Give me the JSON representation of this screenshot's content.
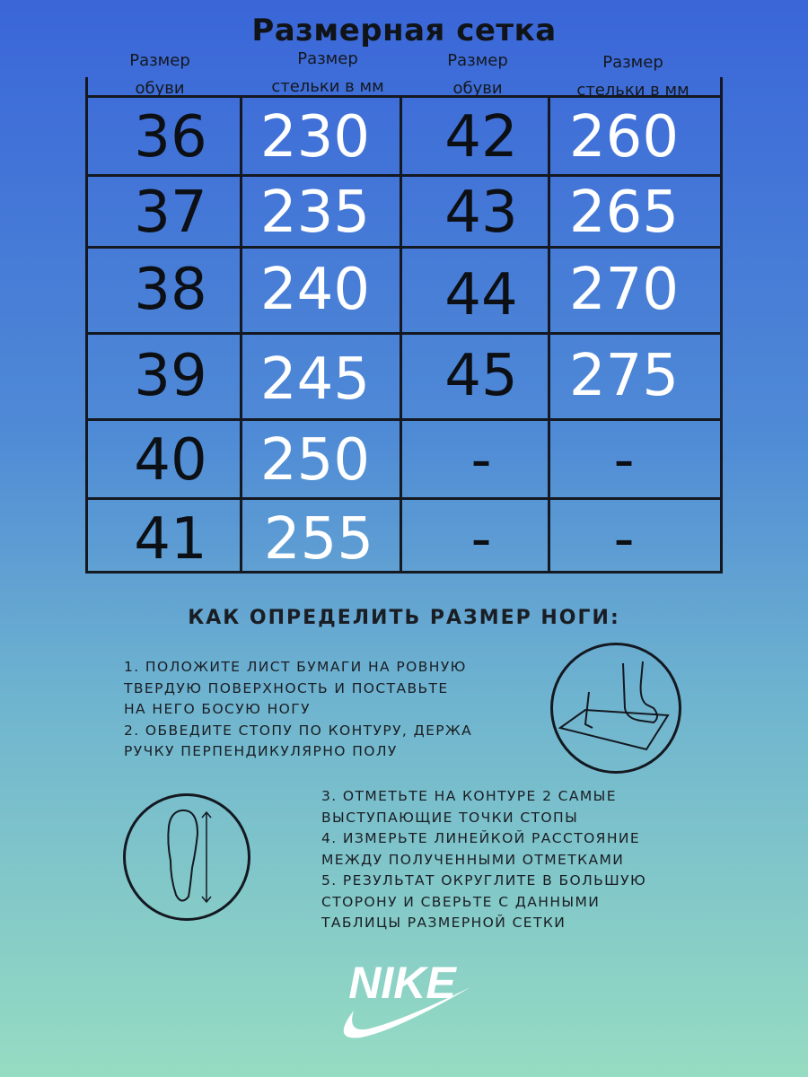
{
  "title": "Размерная сетка",
  "headers": [
    {
      "line1": "Размер",
      "line2": "обуви"
    },
    {
      "line1": "Размер",
      "line2": "стельки в мм"
    },
    {
      "line1": "Размер",
      "line2": "обуви"
    },
    {
      "line1": "Размер",
      "line2": "стельки в мм"
    }
  ],
  "rows": [
    {
      "shoe_a": "36",
      "insole_a": "230",
      "shoe_b": "42",
      "insole_b": "260"
    },
    {
      "shoe_a": "37",
      "insole_a": "235",
      "shoe_b": "43",
      "insole_b": "265"
    },
    {
      "shoe_a": "38",
      "insole_a": "240",
      "shoe_b": "44",
      "insole_b": "270"
    },
    {
      "shoe_a": "39",
      "insole_a": "245",
      "shoe_b": "45",
      "insole_b": "275"
    },
    {
      "shoe_a": "40",
      "insole_a": "250",
      "shoe_b": "-",
      "insole_b": "-"
    },
    {
      "shoe_a": "41",
      "insole_a": "255",
      "shoe_b": "-",
      "insole_b": "-"
    }
  ],
  "howto": {
    "title": "КАК ОПРЕДЕЛИТЬ РАЗМЕР НОГИ:",
    "block1": [
      "1. положите лист бумаги на ровную",
      "твердую поверхность и поставьте",
      "на него босую ногу",
      "2. обведите стопу по контуру, держа",
      "ручку перпендикулярно полу"
    ],
    "block2": [
      "3. отметьте на контуре 2 самые",
      "выступающие точки стопы",
      "4. измерьте линейкой расстояние",
      "между полученными отметками",
      "5. результат округлите в большую",
      "сторону и сверьте с данными",
      "таблицы размерной сетки"
    ]
  },
  "icons": [
    "foot-on-paper-icon",
    "footprint-measure-icon",
    "nike-swoosh-icon"
  ],
  "brand": {
    "logo_text": "NIKE"
  },
  "colors": {
    "bg_top": "#3a66d8",
    "bg_bottom": "#96dcc2",
    "grid_lines": "#141820",
    "insole_text": "#ffffff",
    "shoe_text": "#0c0f14"
  }
}
